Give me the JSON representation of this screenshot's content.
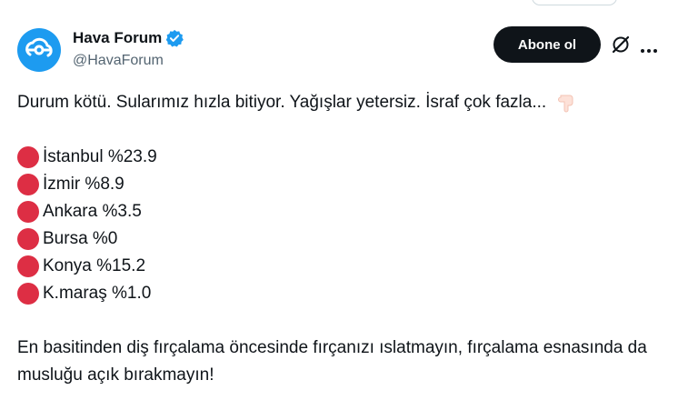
{
  "profile": {
    "display_name": "Hava Forum",
    "handle": "@HavaForum",
    "verified_icon": "verified-badge-icon",
    "avatar_icon": "cloud-logo-icon"
  },
  "actions": {
    "subscribe_label": "Abone ol",
    "grok_icon": "grok-icon",
    "more_icon": "more-options-icon"
  },
  "tweet": {
    "intro": "Durum kötü. Sularımız hızla bitiyor. Yağışlar yetersiz. İsraf çok fazla...",
    "intro_emoji": "pointing-down-icon",
    "cities": [
      {
        "label": "İstanbul %23.9"
      },
      {
        "label": "İzmir %8.9"
      },
      {
        "label": "Ankara %3.5"
      },
      {
        "label": "Bursa %0"
      },
      {
        "label": "Konya %15.2"
      },
      {
        "label": "K.maraş %1.0"
      }
    ],
    "bullet_icon": "red-circle-icon",
    "outro": "En basitinden diş fırçalama öncesinde fırçanızı ıslatmayın, fırçalama esnasında da musluğu açık bırakmayın!"
  },
  "colors": {
    "brand_blue": "#1d9bf0",
    "text": "#0f1419",
    "muted": "#536471",
    "bullet_red": "#dd2e44",
    "button_bg": "#0f1419"
  }
}
